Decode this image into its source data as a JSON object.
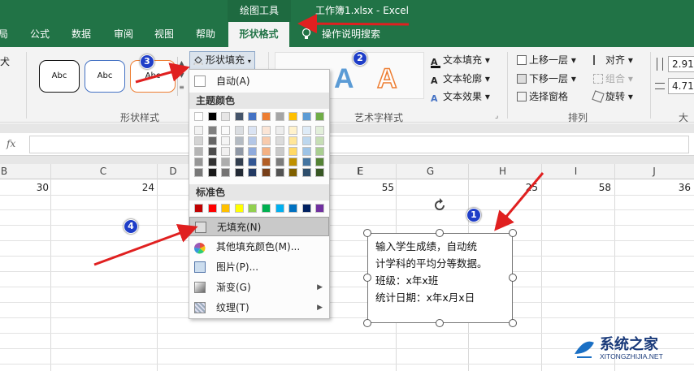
{
  "titlebar": {
    "tool_label": "绘图工具",
    "document": "工作簿1.xlsx  -  Excel"
  },
  "tabs": [
    "局",
    "公式",
    "数据",
    "审阅",
    "视图",
    "帮助",
    "形状格式"
  ],
  "tell_me": "操作说明搜索",
  "ribbon": {
    "shape_styles_label": "形状样式",
    "abc": "Abc",
    "shape_fill_button": "形状填充",
    "art_label": "艺术字样式",
    "text_fill": "文本填充",
    "text_outline": "文本轮廓",
    "text_effect": "文本效果",
    "arrange_label": "排列",
    "bring_forward": "上移一层",
    "send_backward": "下移一层",
    "selection_pane": "选择窗格",
    "align": "对齐",
    "group": "组合",
    "rotate": "旋转",
    "size_label": "大小",
    "height_value": "2.91",
    "width_value": "4.71",
    "left_stub": "犬"
  },
  "formula_bar": {
    "fx": "fx"
  },
  "columns": [
    "B",
    "C",
    "D",
    "E",
    "F",
    "G",
    "H",
    "I",
    "J"
  ],
  "row_values": [
    "30",
    "24",
    "55",
    "25",
    "58",
    "36"
  ],
  "menu": {
    "auto": "自动(A)",
    "theme_colors": "主题颜色",
    "standard_colors": "标准色",
    "no_fill": "无填充(N)",
    "more_colors": "其他填充颜色(M)...",
    "picture": "图片(P)...",
    "gradient": "渐变(G)",
    "texture": "纹理(T)"
  },
  "theme_palette": [
    "#ffffff",
    "#000000",
    "#e7e6e6",
    "#44546a",
    "#4472c4",
    "#ed7d31",
    "#a5a5a5",
    "#ffc000",
    "#5b9bd5",
    "#70ad47"
  ],
  "standard_palette": [
    "#c00000",
    "#ff0000",
    "#ffc000",
    "#ffff00",
    "#92d050",
    "#00b050",
    "#00b0f0",
    "#0070c0",
    "#002060",
    "#7030a0"
  ],
  "textbox_lines": [
    "输入学生成绩，自动统",
    "计学科的平均分等数据。",
    "班级：x年x班",
    "统计日期：x年x月x日"
  ],
  "badges": [
    "1",
    "2",
    "3",
    "4"
  ],
  "watermark": {
    "name": "系统之家",
    "url": "XITONGZHIJIA.NET"
  },
  "colors": {
    "excel_green": "#217346",
    "arrow_red": "#e02020",
    "badge_blue": "#1f3ec8"
  }
}
